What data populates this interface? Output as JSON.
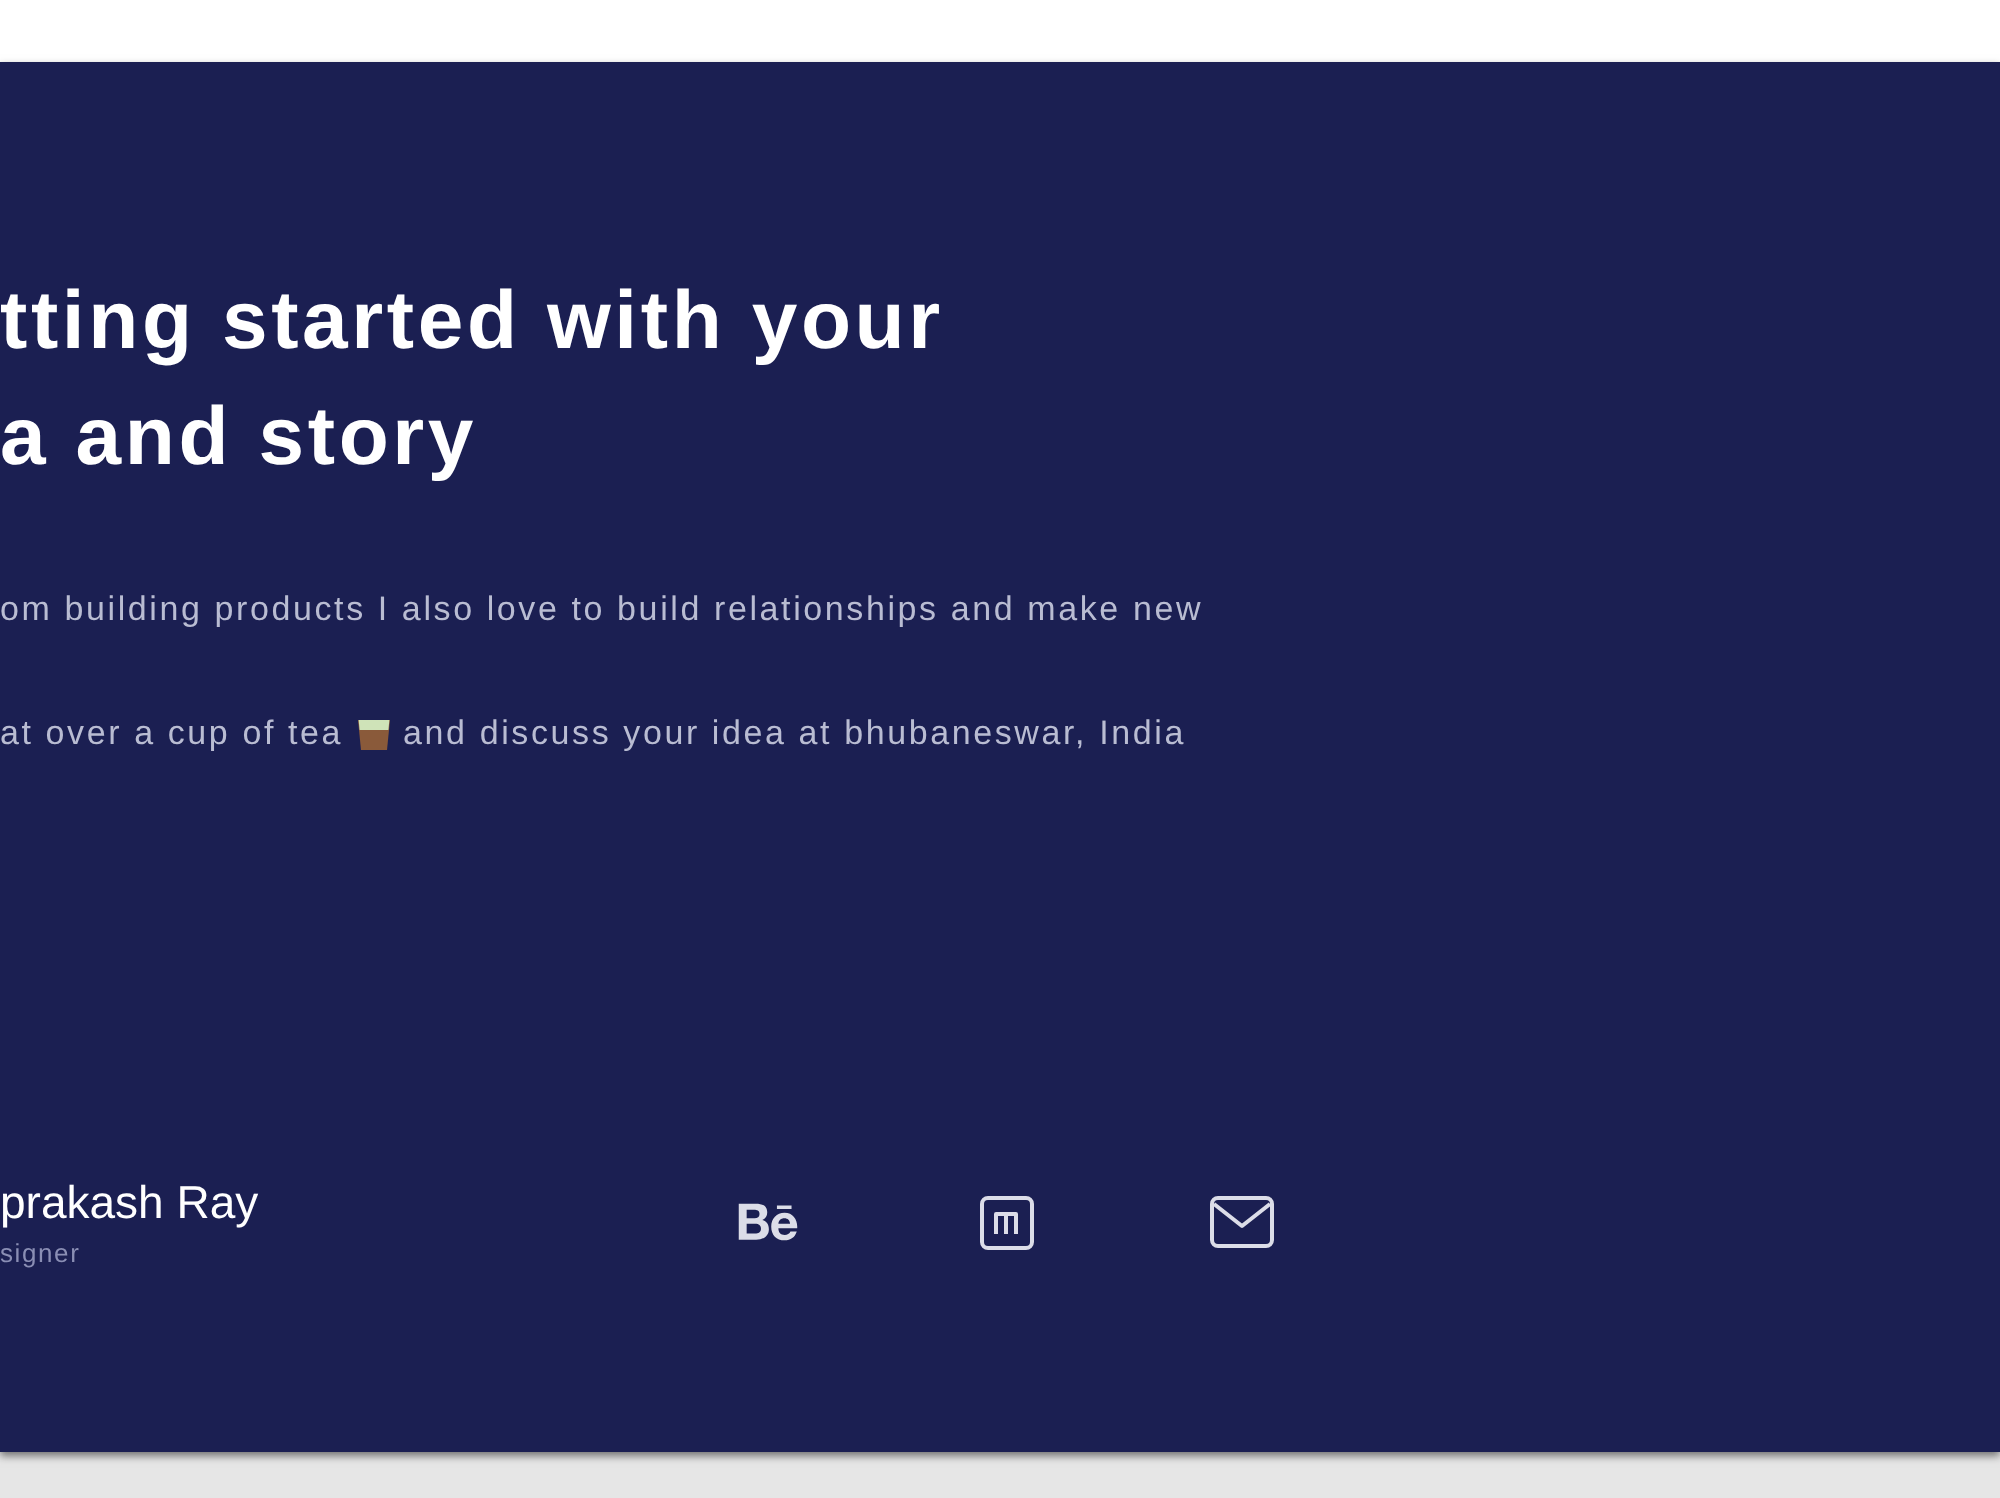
{
  "hero": {
    "heading_lines": [
      "tting started with your",
      "a and story"
    ],
    "paragraph_lines": [
      [
        "om building products I also love to build relationships and make new"
      ],
      [
        "at over a cup of tea",
        "and discuss your idea at bhubaneswar, India"
      ]
    ]
  },
  "footer": {
    "name": "prakash Ray",
    "role": "signer"
  }
}
